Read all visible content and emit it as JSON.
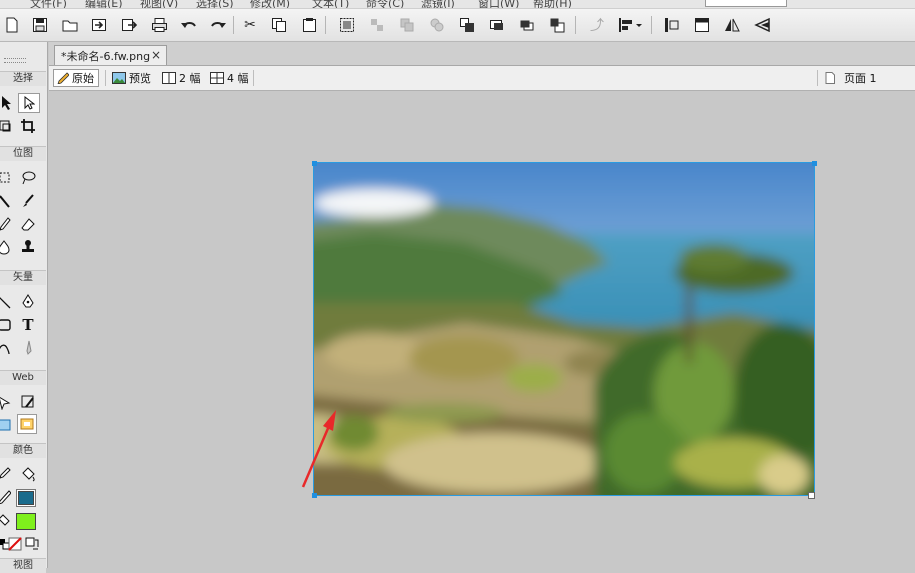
{
  "menu": [
    "文件(F)",
    "编辑(E)",
    "视图(V)",
    "选择(S)",
    "修改(M)",
    "文本(T)",
    "命令(C)",
    "滤镜(I)",
    "窗口(W)",
    "帮助(H)"
  ],
  "toolbar_icons": [
    "new-file-icon",
    "save-icon",
    "open-icon",
    "import-icon",
    "export-icon",
    "print-icon",
    "undo-icon",
    "redo-icon",
    "cut-icon",
    "copy-icon",
    "paste-icon",
    "group-icon",
    "ungroup-icon",
    "join-icon",
    "split-icon",
    "bring-front-icon",
    "bring-forward-icon",
    "send-backward-icon",
    "send-back-icon",
    "rotate-icon",
    "align-icon",
    "flip-h-icon",
    "fit-icon",
    "flip-icon",
    "skew-icon"
  ],
  "tools": {
    "sections": {
      "select": "选择",
      "bitmap": "位图",
      "vector": "矢量",
      "web": "Web",
      "colors": "颜色",
      "view": "视图"
    },
    "stroke_color": "#1a6b8c",
    "fill_color": "#7ff01c"
  },
  "document": {
    "tab_title": "*未命名-6.fw.png",
    "close_glyph": "×"
  },
  "viewbar": {
    "original_label": "原始",
    "preview_label": "预览",
    "two_up_label": "2 幅",
    "four_up_label": "4 幅",
    "page_label": "页面 1"
  },
  "colors": {
    "selection_outline": "#2a9be0",
    "arrow": "#e8292a"
  }
}
